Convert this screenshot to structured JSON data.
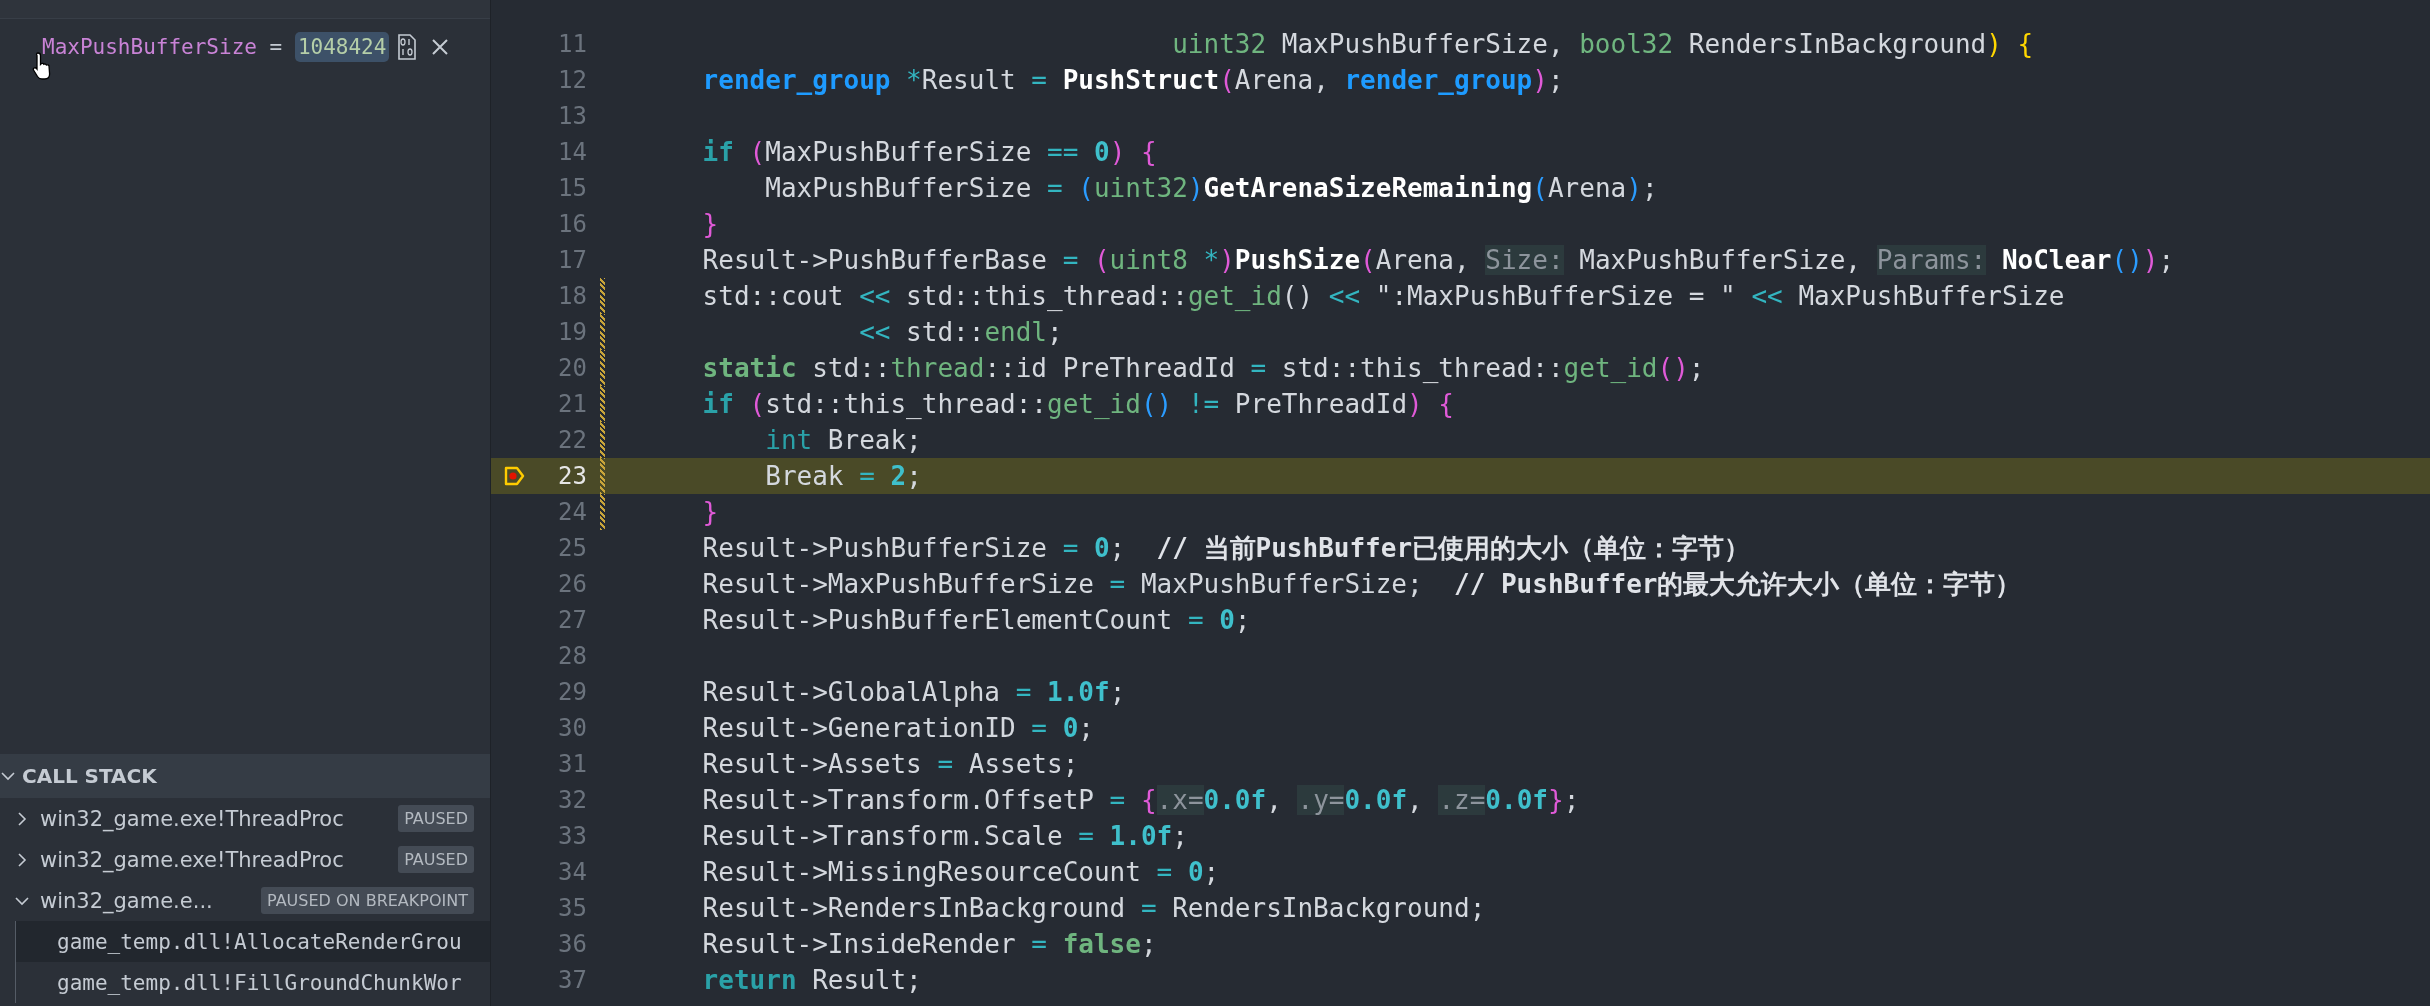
{
  "watch": {
    "expressions": [
      {
        "name": "MaxPushBufferSize",
        "separator": " = ",
        "value": "1048424"
      }
    ]
  },
  "call_stack": {
    "title": "CALL STACK",
    "expanded": true,
    "threads": [
      {
        "name": "win32_game.exe!ThreadProc",
        "status": "PAUSED",
        "expanded": false
      },
      {
        "name": "win32_game.exe!ThreadProc",
        "status": "PAUSED",
        "expanded": false
      },
      {
        "name": "win32_game.e...",
        "status": "PAUSED ON BREAKPOINT",
        "expanded": true,
        "frames": [
          {
            "name": "game_temp.dll!AllocateRenderGrou",
            "selected": true
          },
          {
            "name": "game_temp.dll!FillGroundChunkWor",
            "selected": false
          }
        ]
      }
    ]
  },
  "editor": {
    "lines": [
      {
        "number": "11",
        "current": false,
        "modified": false,
        "breakpoint": false,
        "tokens": [
          {
            "kind": "typename",
            "text": "                                  uint32"
          },
          {
            "kind": "plain",
            "text": " MaxPushBufferSize, "
          },
          {
            "kind": "typename",
            "text": "bool32"
          },
          {
            "kind": "plain",
            "text": " RendersInBackground"
          },
          {
            "kind": "bracket3",
            "text": ") "
          },
          {
            "kind": "bracket3",
            "text": "{"
          }
        ]
      },
      {
        "number": "12",
        "current": false,
        "modified": false,
        "breakpoint": false,
        "tokens": [
          {
            "kind": "type",
            "text": "    render_group "
          },
          {
            "kind": "operator",
            "text": "*"
          },
          {
            "kind": "plain",
            "text": "Result "
          },
          {
            "kind": "operator",
            "text": "= "
          },
          {
            "kind": "function",
            "text": "PushStruct"
          },
          {
            "kind": "bracket1",
            "text": "("
          },
          {
            "kind": "plain",
            "text": "Arena, "
          },
          {
            "kind": "type",
            "text": "render_group"
          },
          {
            "kind": "bracket1",
            "text": ")"
          },
          {
            "kind": "plain",
            "text": ";"
          }
        ]
      },
      {
        "number": "13",
        "current": false,
        "modified": false,
        "breakpoint": false
      },
      {
        "number": "14",
        "current": false,
        "modified": false,
        "breakpoint": false,
        "tokens": [
          {
            "kind": "keyword",
            "text": "    if "
          },
          {
            "kind": "bracket1",
            "text": "("
          },
          {
            "kind": "plain",
            "text": "MaxPushBufferSize "
          },
          {
            "kind": "operator",
            "text": "== "
          },
          {
            "kind": "number",
            "text": "0"
          },
          {
            "kind": "bracket1",
            "text": ") "
          },
          {
            "kind": "bracket1",
            "text": "{"
          }
        ]
      },
      {
        "number": "15",
        "current": false,
        "modified": false,
        "breakpoint": false,
        "tokens": [
          {
            "kind": "plain",
            "text": "        MaxPushBufferSize "
          },
          {
            "kind": "operator",
            "text": "= "
          },
          {
            "kind": "bracket2",
            "text": "("
          },
          {
            "kind": "typename",
            "text": "uint32"
          },
          {
            "kind": "bracket2",
            "text": ")"
          },
          {
            "kind": "function",
            "text": "GetArenaSizeRemaining"
          },
          {
            "kind": "bracket2",
            "text": "("
          },
          {
            "kind": "plain",
            "text": "Arena"
          },
          {
            "kind": "bracket2",
            "text": ")"
          },
          {
            "kind": "plain",
            "text": ";"
          }
        ]
      },
      {
        "number": "16",
        "current": false,
        "modified": false,
        "breakpoint": false,
        "tokens": [
          {
            "kind": "bracket1",
            "text": "    }"
          }
        ]
      },
      {
        "number": "17",
        "current": false,
        "modified": false,
        "breakpoint": false,
        "tokens": [
          {
            "kind": "plain",
            "text": "    Result->PushBufferBase "
          },
          {
            "kind": "operator",
            "text": "= "
          },
          {
            "kind": "bracket1",
            "text": "("
          },
          {
            "kind": "typename",
            "text": "uint8 "
          },
          {
            "kind": "operator",
            "text": "*"
          },
          {
            "kind": "bracket1",
            "text": ")"
          },
          {
            "kind": "function",
            "text": "PushSize"
          },
          {
            "kind": "bracket1",
            "text": "("
          },
          {
            "kind": "plain",
            "text": "Arena, "
          },
          {
            "kind": "hint",
            "text": "Size:"
          },
          {
            "kind": "plain",
            "text": " MaxPushBufferSize, "
          },
          {
            "kind": "hint",
            "text": "Params:"
          },
          {
            "kind": "function",
            "text": " NoClear"
          },
          {
            "kind": "bracket2",
            "text": "()"
          },
          {
            "kind": "bracket1",
            "text": ")"
          },
          {
            "kind": "plain",
            "text": ";"
          }
        ]
      },
      {
        "number": "18",
        "current": false,
        "modified": true,
        "breakpoint": false,
        "tokens": [
          {
            "kind": "plain",
            "text": "    std::cout "
          },
          {
            "kind": "operator",
            "text": "<<"
          },
          {
            "kind": "plain",
            "text": " std::this_thread::"
          },
          {
            "kind": "typename",
            "text": "get_id"
          },
          {
            "kind": "plain",
            "text": "() "
          },
          {
            "kind": "operator",
            "text": "<<"
          },
          {
            "kind": "plain",
            "text": " \":MaxPushBufferSize = \" "
          },
          {
            "kind": "operator",
            "text": "<<"
          },
          {
            "kind": "plain",
            "text": " MaxPushBufferSize"
          }
        ]
      },
      {
        "number": "19",
        "current": false,
        "modified": true,
        "breakpoint": false,
        "tokens": [
          {
            "kind": "operator",
            "text": "              <<"
          },
          {
            "kind": "plain",
            "text": " std::"
          },
          {
            "kind": "typename",
            "text": "endl"
          },
          {
            "kind": "plain",
            "text": ";"
          }
        ]
      },
      {
        "number": "20",
        "current": false,
        "modified": true,
        "breakpoint": false,
        "tokens": [
          {
            "kind": "storage",
            "text": "    static"
          },
          {
            "kind": "plain",
            "text": " std::"
          },
          {
            "kind": "typename",
            "text": "thread"
          },
          {
            "kind": "plain",
            "text": "::id PreThreadId "
          },
          {
            "kind": "operator",
            "text": "="
          },
          {
            "kind": "plain",
            "text": " std::this_thread::"
          },
          {
            "kind": "typename",
            "text": "get_id"
          },
          {
            "kind": "bracket1",
            "text": "()"
          },
          {
            "kind": "plain",
            "text": ";"
          }
        ]
      },
      {
        "number": "21",
        "current": false,
        "modified": true,
        "breakpoint": false,
        "tokens": [
          {
            "kind": "keyword",
            "text": "    if "
          },
          {
            "kind": "bracket1",
            "text": "("
          },
          {
            "kind": "plain",
            "text": "std::this_thread::"
          },
          {
            "kind": "typename",
            "text": "get_id"
          },
          {
            "kind": "bracket2",
            "text": "() "
          },
          {
            "kind": "operator",
            "text": "!="
          },
          {
            "kind": "plain",
            "text": " PreThreadId"
          },
          {
            "kind": "bracket1",
            "text": ") "
          },
          {
            "kind": "bracket1",
            "text": "{"
          }
        ]
      },
      {
        "number": "22",
        "current": false,
        "modified": true,
        "breakpoint": false,
        "tokens": [
          {
            "kind": "builtin",
            "text": "        int"
          },
          {
            "kind": "plain",
            "text": " Break;"
          }
        ]
      },
      {
        "number": "23",
        "current": true,
        "modified": true,
        "breakpoint": true,
        "tokens": [
          {
            "kind": "plain",
            "text": "        Break "
          },
          {
            "kind": "operator",
            "text": "= "
          },
          {
            "kind": "number",
            "text": "2"
          },
          {
            "kind": "plain",
            "text": ";"
          }
        ]
      },
      {
        "number": "24",
        "current": false,
        "modified": true,
        "breakpoint": false,
        "tokens": [
          {
            "kind": "bracket1",
            "text": "    }"
          }
        ]
      },
      {
        "number": "25",
        "current": false,
        "modified": false,
        "breakpoint": false,
        "tokens": [
          {
            "kind": "plain",
            "text": "    Result->PushBufferSize "
          },
          {
            "kind": "operator",
            "text": "= "
          },
          {
            "kind": "number",
            "text": "0"
          },
          {
            "kind": "plain",
            "text": ";  "
          },
          {
            "kind": "comment",
            "text": "// 当前PushBuffer已使用的大小（单位：字节）"
          }
        ]
      },
      {
        "number": "26",
        "current": false,
        "modified": false,
        "breakpoint": false,
        "tokens": [
          {
            "kind": "plain",
            "text": "    Result->MaxPushBufferSize "
          },
          {
            "kind": "operator",
            "text": "="
          },
          {
            "kind": "plain",
            "text": " MaxPushBufferSize;  "
          },
          {
            "kind": "comment",
            "text": "// PushBuffer的最大允许大小（单位：字节）"
          }
        ]
      },
      {
        "number": "27",
        "current": false,
        "modified": false,
        "breakpoint": false,
        "tokens": [
          {
            "kind": "plain",
            "text": "    Result->PushBufferElementCount "
          },
          {
            "kind": "operator",
            "text": "= "
          },
          {
            "kind": "number",
            "text": "0"
          },
          {
            "kind": "plain",
            "text": ";"
          }
        ]
      },
      {
        "number": "28",
        "current": false,
        "modified": false,
        "breakpoint": false
      },
      {
        "number": "29",
        "current": false,
        "modified": false,
        "breakpoint": false,
        "tokens": [
          {
            "kind": "plain",
            "text": "    Result->GlobalAlpha "
          },
          {
            "kind": "operator",
            "text": "= "
          },
          {
            "kind": "number",
            "text": "1.0f"
          },
          {
            "kind": "plain",
            "text": ";"
          }
        ]
      },
      {
        "number": "30",
        "current": false,
        "modified": false,
        "breakpoint": false,
        "tokens": [
          {
            "kind": "plain",
            "text": "    Result->GenerationID "
          },
          {
            "kind": "operator",
            "text": "= "
          },
          {
            "kind": "number",
            "text": "0"
          },
          {
            "kind": "plain",
            "text": ";"
          }
        ]
      },
      {
        "number": "31",
        "current": false,
        "modified": false,
        "breakpoint": false,
        "tokens": [
          {
            "kind": "plain",
            "text": "    Result->Assets "
          },
          {
            "kind": "operator",
            "text": "="
          },
          {
            "kind": "plain",
            "text": " Assets;"
          }
        ]
      },
      {
        "number": "32",
        "current": false,
        "modified": false,
        "breakpoint": false,
        "tokens": [
          {
            "kind": "plain",
            "text": "    Result->Transform.OffsetP "
          },
          {
            "kind": "operator",
            "text": "= "
          },
          {
            "kind": "bracket1",
            "text": "{"
          },
          {
            "kind": "hint",
            "text": ".x="
          },
          {
            "kind": "number",
            "text": "0.0f"
          },
          {
            "kind": "plain",
            "text": ", "
          },
          {
            "kind": "hint",
            "text": ".y="
          },
          {
            "kind": "number",
            "text": "0.0f"
          },
          {
            "kind": "plain",
            "text": ", "
          },
          {
            "kind": "hint",
            "text": ".z="
          },
          {
            "kind": "number",
            "text": "0.0f"
          },
          {
            "kind": "bracket1",
            "text": "}"
          },
          {
            "kind": "plain",
            "text": ";"
          }
        ]
      },
      {
        "number": "33",
        "current": false,
        "modified": false,
        "breakpoint": false,
        "tokens": [
          {
            "kind": "plain",
            "text": "    Result->Transform.Scale "
          },
          {
            "kind": "operator",
            "text": "= "
          },
          {
            "kind": "number",
            "text": "1.0f"
          },
          {
            "kind": "plain",
            "text": ";"
          }
        ]
      },
      {
        "number": "34",
        "current": false,
        "modified": false,
        "breakpoint": false,
        "tokens": [
          {
            "kind": "plain",
            "text": "    Result->MissingResourceCount "
          },
          {
            "kind": "operator",
            "text": "= "
          },
          {
            "kind": "number",
            "text": "0"
          },
          {
            "kind": "plain",
            "text": ";"
          }
        ]
      },
      {
        "number": "35",
        "current": false,
        "modified": false,
        "breakpoint": false,
        "tokens": [
          {
            "kind": "plain",
            "text": "    Result->RendersInBackground "
          },
          {
            "kind": "operator",
            "text": "="
          },
          {
            "kind": "plain",
            "text": " RendersInBackground;"
          }
        ]
      },
      {
        "number": "36",
        "current": false,
        "modified": false,
        "breakpoint": false,
        "tokens": [
          {
            "kind": "plain",
            "text": "    Result->InsideRender "
          },
          {
            "kind": "operator",
            "text": "= "
          },
          {
            "kind": "storage",
            "text": "false"
          },
          {
            "kind": "plain",
            "text": ";"
          }
        ]
      },
      {
        "number": "37",
        "current": false,
        "modified": false,
        "breakpoint": false,
        "tokens": [
          {
            "kind": "keyword",
            "text": "    return"
          },
          {
            "kind": "plain",
            "text": " Result;"
          }
        ]
      }
    ]
  }
}
